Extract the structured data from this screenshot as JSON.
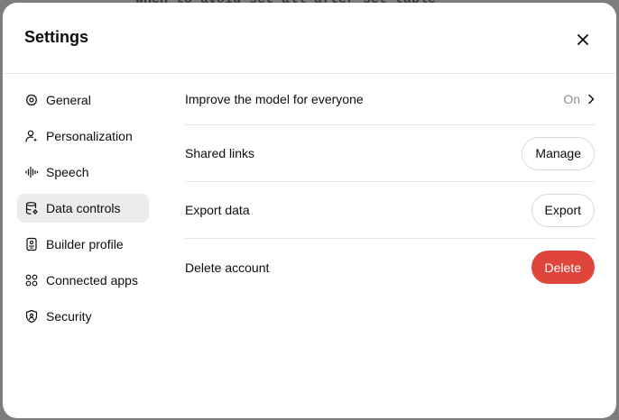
{
  "background": {
    "top_text": "When to avoid set_all_after_set_table"
  },
  "modal": {
    "title": "Settings",
    "close_icon": "close-icon"
  },
  "sidebar": {
    "items": [
      {
        "label": "General",
        "icon": "gear-icon",
        "active": false
      },
      {
        "label": "Personalization",
        "icon": "person-sparkle-icon",
        "active": false
      },
      {
        "label": "Speech",
        "icon": "waveform-icon",
        "active": false
      },
      {
        "label": "Data controls",
        "icon": "database-icon",
        "active": true
      },
      {
        "label": "Builder profile",
        "icon": "id-card-icon",
        "active": false
      },
      {
        "label": "Connected apps",
        "icon": "apps-grid-icon",
        "active": false
      },
      {
        "label": "Security",
        "icon": "shield-icon",
        "active": false
      }
    ]
  },
  "data_controls": {
    "improve_model": {
      "label": "Improve the model for everyone",
      "value": "On"
    },
    "shared_links": {
      "label": "Shared links",
      "button": "Manage"
    },
    "export_data": {
      "label": "Export data",
      "button": "Export"
    },
    "delete_account": {
      "label": "Delete account",
      "button": "Delete"
    }
  },
  "colors": {
    "danger": "#e0453c",
    "active_nav_bg": "#ececec",
    "divider": "#e5e5e5",
    "muted_text": "#8f8f8f"
  }
}
